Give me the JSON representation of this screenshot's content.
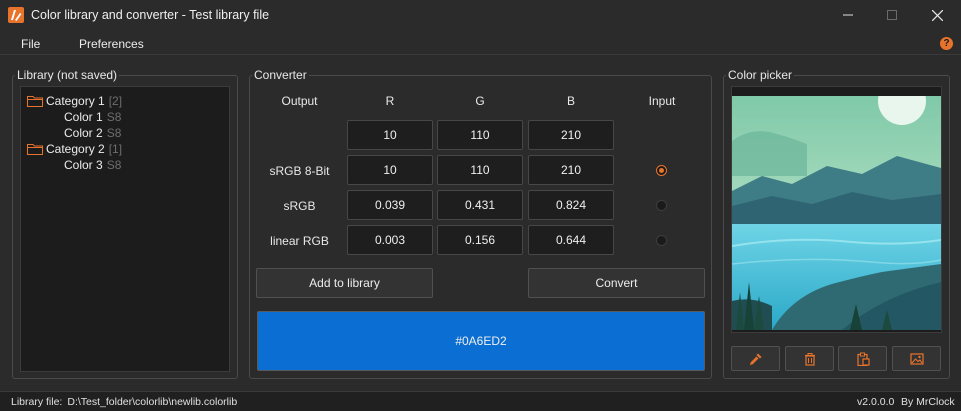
{
  "window": {
    "title": "Color library and converter - Test library file",
    "app_icon": "palette-app-icon",
    "buttons": [
      "minimize-icon",
      "maximize-icon",
      "close-icon"
    ]
  },
  "menu": {
    "items": [
      "File",
      "Preferences"
    ],
    "help_icon": "help-icon",
    "help_glyph": "?"
  },
  "library": {
    "title": "Library (not saved)",
    "tree": [
      {
        "type": "category",
        "label": "Category 1",
        "meta": "[2]"
      },
      {
        "type": "color",
        "label": "Color 1",
        "meta": "S8"
      },
      {
        "type": "color",
        "label": "Color 2",
        "meta": "S8"
      },
      {
        "type": "category",
        "label": "Category 2",
        "meta": "[1]"
      },
      {
        "type": "color",
        "label": "Color 3",
        "meta": "S8"
      }
    ]
  },
  "converter": {
    "title": "Converter",
    "headers": {
      "output": "Output",
      "r": "R",
      "g": "G",
      "b": "B",
      "input": "Input"
    },
    "output_row": {
      "r": "10",
      "g": "110",
      "b": "210"
    },
    "rows": [
      {
        "label": "sRGB 8-Bit",
        "r": "10",
        "g": "110",
        "b": "210",
        "selected": true
      },
      {
        "label": "sRGB",
        "r": "0.039",
        "g": "0.431",
        "b": "0.824",
        "selected": false
      },
      {
        "label": "linear RGB",
        "r": "0.003",
        "g": "0.156",
        "b": "0.644",
        "selected": false
      }
    ],
    "add_button": "Add to library",
    "convert_button": "Convert",
    "preview_hex": "#0A6ED2",
    "preview_color": "#0A6ED2"
  },
  "picker": {
    "title": "Color picker",
    "tools": [
      "eyedropper-icon",
      "trash-icon",
      "paste-icon",
      "image-icon"
    ]
  },
  "status": {
    "label": "Library file:",
    "path": "D:\\Test_folder\\colorlib\\newlib.colorlib",
    "version": "v2.0.0.0",
    "author": "By MrClock"
  },
  "colors": {
    "accent": "#E8742C",
    "background": "#2B2B2B",
    "field": "#1E1E1E"
  }
}
